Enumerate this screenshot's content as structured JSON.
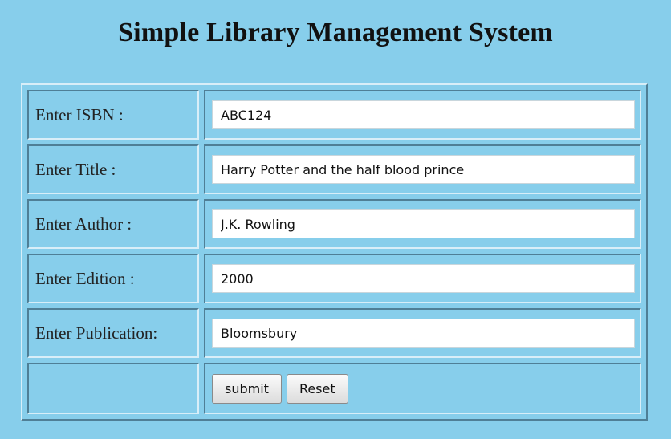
{
  "page": {
    "title": "Simple Library Management System"
  },
  "form": {
    "fields": [
      {
        "label": "Enter ISBN :",
        "value": "ABC124"
      },
      {
        "label": "Enter Title :",
        "value": "Harry Potter and the half blood prince"
      },
      {
        "label": "Enter Author :",
        "value": "J.K. Rowling"
      },
      {
        "label": "Enter Edition :",
        "value": "2000"
      },
      {
        "label": "Enter Publication:",
        "value": "Bloomsbury"
      }
    ],
    "submit_label": "submit",
    "reset_label": "Reset"
  },
  "colors": {
    "background": "#87ceeb"
  }
}
